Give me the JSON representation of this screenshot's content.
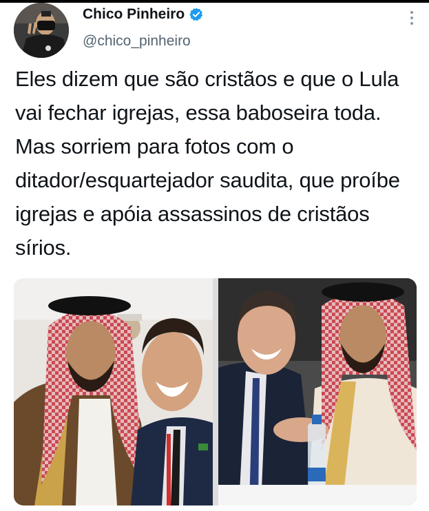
{
  "tweet": {
    "author_name": "Chico Pinheiro",
    "handle": "@chico_pinheiro",
    "verified": true,
    "text": "Eles dizem que são cristãos e que o Lula vai fechar igrejas, essa baboseira toda. Mas sorriem para fotos com o ditador/esquartejador saudita, que proíbe igrejas e apóia assassinos de cristãos sírios.",
    "media": [
      {
        "description": "selfie of two men"
      },
      {
        "description": "two men shaking hands at a table"
      }
    ]
  },
  "colors": {
    "verified_badge": "#1d9bf0",
    "text": "#0f1419",
    "secondary_text": "#536471",
    "menu_dots": "#8b98a5"
  },
  "icons": {
    "verified": "verified-badge-icon",
    "more": "more-options-icon"
  }
}
